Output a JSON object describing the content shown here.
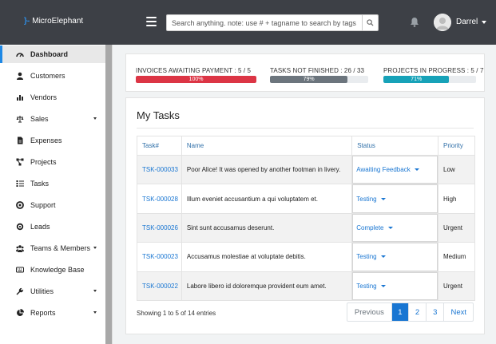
{
  "app": {
    "brand": "MicroElephant",
    "logo_glyph": "}-"
  },
  "topbar": {
    "search_placeholder": "Search anything. note: use # + tagname to search by tags",
    "user_name": "Darrel",
    "icons": {
      "menu": "hamburger-icon",
      "search": "search-icon",
      "notifications": "bell-icon"
    }
  },
  "sidebar": {
    "items": [
      {
        "label": "Dashboard",
        "icon": "dashboard-icon",
        "active": true,
        "submenu": false
      },
      {
        "label": "Customers",
        "icon": "user-icon",
        "active": false,
        "submenu": false
      },
      {
        "label": "Vendors",
        "icon": "bar-chart-icon",
        "active": false,
        "submenu": false
      },
      {
        "label": "Sales",
        "icon": "balance-scale-icon",
        "active": false,
        "submenu": true
      },
      {
        "label": "Expenses",
        "icon": "file-icon",
        "active": false,
        "submenu": false
      },
      {
        "label": "Projects",
        "icon": "project-diagram-icon",
        "active": false,
        "submenu": false
      },
      {
        "label": "Tasks",
        "icon": "tasks-icon",
        "active": false,
        "submenu": false
      },
      {
        "label": "Support",
        "icon": "support-icon",
        "active": false,
        "submenu": false
      },
      {
        "label": "Leads",
        "icon": "leads-icon",
        "active": false,
        "submenu": false
      },
      {
        "label": "Teams & Members",
        "icon": "users-icon",
        "active": false,
        "submenu": true
      },
      {
        "label": "Knowledge Base",
        "icon": "keyboard-icon",
        "active": false,
        "submenu": false
      },
      {
        "label": "Utilities",
        "icon": "wrench-icon",
        "active": false,
        "submenu": true
      },
      {
        "label": "Reports",
        "icon": "pie-chart-icon",
        "active": false,
        "submenu": true
      }
    ]
  },
  "progress": [
    {
      "label": "INVOICES AWAITING PAYMENT : 5 / 5",
      "percent_text": "100%",
      "value": 100,
      "color": "#dc3545"
    },
    {
      "label": "TASKS NOT FINISHED : 26 / 33",
      "percent_text": "79%",
      "value": 79,
      "color": "#6c757d"
    },
    {
      "label": "PROJECTS IN PROGRESS : 5 / 7",
      "percent_text": "71%",
      "value": 71,
      "color": "#17a2b8"
    }
  ],
  "tasks": {
    "title": "My Tasks",
    "columns": [
      "Task#",
      "Name",
      "Status",
      "Priority"
    ],
    "rows": [
      {
        "id": "TSK-000033",
        "name": "Poor Alice! It was opened by another footman in livery.",
        "status": "Awaiting Feedback",
        "priority": "Low"
      },
      {
        "id": "TSK-000028",
        "name": "Illum eveniet accusantium a qui voluptatem et.",
        "status": "Testing",
        "priority": "High"
      },
      {
        "id": "TSK-000026",
        "name": "Sint sunt accusamus deserunt.",
        "status": "Complete",
        "priority": "Urgent"
      },
      {
        "id": "TSK-000023",
        "name": "Accusamus molestiae at voluptate debitis.",
        "status": "Testing",
        "priority": "Medium"
      },
      {
        "id": "TSK-000022",
        "name": "Labore libero id doloremque provident eum amet.",
        "status": "Testing",
        "priority": "Urgent"
      }
    ],
    "entries_info": "Showing 1 to 5 of 14 entries",
    "pagination": {
      "previous": "Previous",
      "pages": [
        "1",
        "2",
        "3"
      ],
      "current": "1",
      "next": "Next"
    }
  },
  "colors": {
    "accent": "#1976d2",
    "topbar": "#3d4046"
  }
}
